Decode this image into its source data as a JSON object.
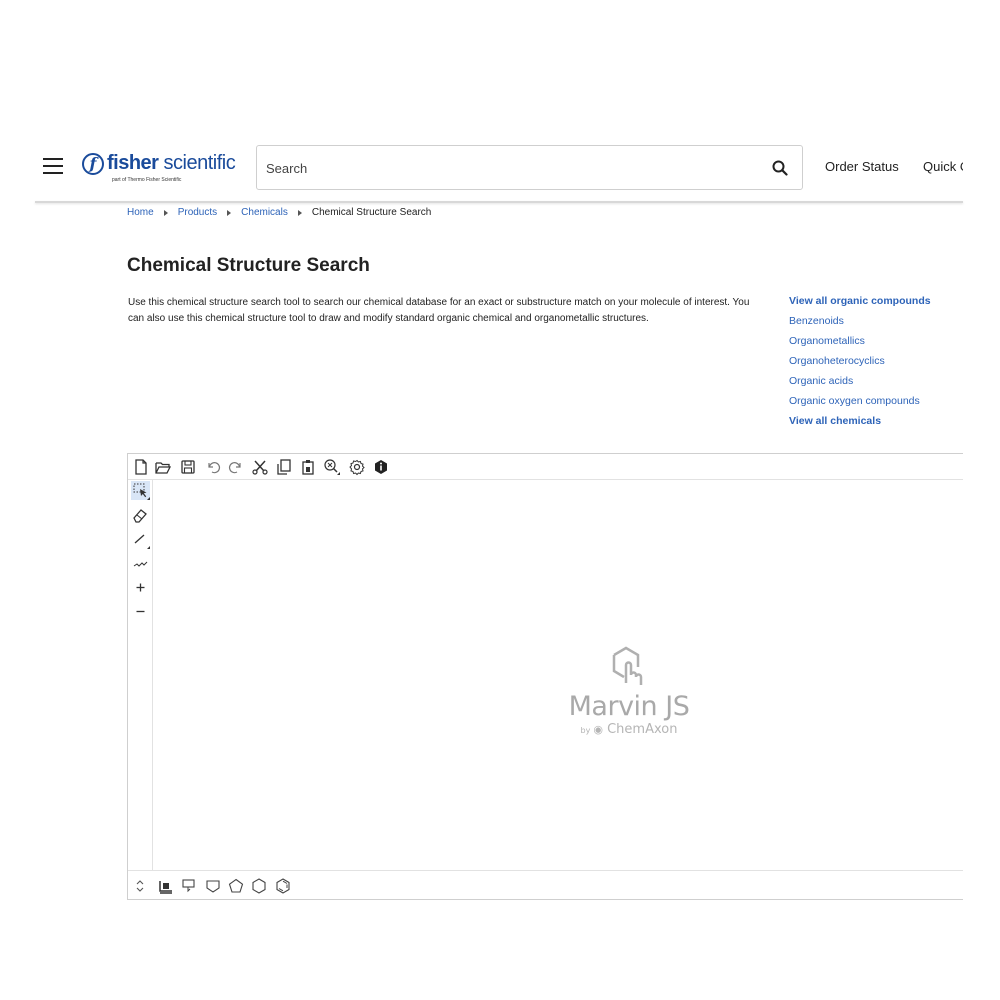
{
  "header": {
    "logo_brand": "fisher scientific",
    "logo_tagline": "part of Thermo Fisher Scientific",
    "search_placeholder": "Search",
    "nav": [
      "Order Status",
      "Quick O"
    ]
  },
  "breadcrumb": {
    "items": [
      "Home",
      "Products",
      "Chemicals"
    ],
    "current": "Chemical Structure Search"
  },
  "page": {
    "title": "Chemical Structure Search",
    "intro": "Use this chemical structure search tool to search our chemical database for an exact or substructure match on your molecule of interest. You can also use this chemical structure tool to draw and modify standard organic chemical and organometallic structures."
  },
  "side_links": [
    {
      "label": "View all organic compounds",
      "bold": true
    },
    {
      "label": "Benzenoids",
      "bold": false
    },
    {
      "label": "Organometallics",
      "bold": false
    },
    {
      "label": "Organoheterocyclics",
      "bold": false
    },
    {
      "label": "Organic acids",
      "bold": false
    },
    {
      "label": "Organic oxygen compounds",
      "bold": false
    },
    {
      "label": "View all chemicals",
      "bold": true
    }
  ],
  "editor": {
    "watermark_title": "Marvin JS",
    "watermark_by": "by",
    "watermark_company": "ChemAxon",
    "top_tools": [
      "new-document-icon",
      "open-folder-icon",
      "save-icon",
      "undo-icon",
      "redo-icon",
      "cut-icon",
      "copy-icon",
      "paste-icon",
      "zoom-icon",
      "settings-icon",
      "info-icon"
    ],
    "left_tools": [
      "rectangle-select-icon",
      "eraser-icon",
      "single-bond-icon",
      "chain-icon",
      "increase-charge-icon",
      "decrease-charge-icon"
    ],
    "bottom_tools": [
      "scroll-arrows-icon",
      "template-library-icon",
      "cyclopropane-icon",
      "cyclobutane-icon",
      "cyclopentane-icon",
      "cyclohexane-icon",
      "benzene-icon"
    ],
    "left_tool_labels": {
      "plus": "+",
      "minus": "−"
    }
  },
  "colors": {
    "brand": "#1a4b9b",
    "link": "#2d63b8",
    "watermark": "#a9a9a9",
    "active_tool_bg": "#d9e6f7"
  }
}
